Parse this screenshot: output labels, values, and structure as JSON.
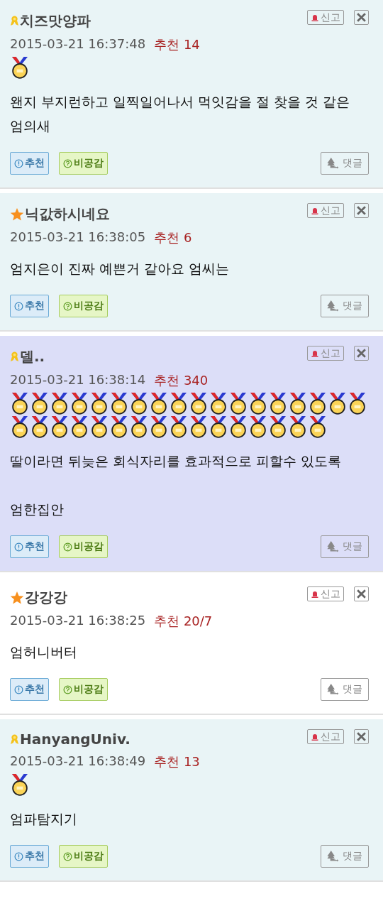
{
  "comments": [
    {
      "kind": "normal",
      "badge": {
        "kind": "ribbon"
      },
      "name": "치즈맛양파",
      "date": "2015-03-21 16:37:48",
      "recommend": "추천 14",
      "medals": [
        {
          "kind": "medal"
        }
      ],
      "body": "왠지 부지런하고 일찍일어나서 먹잇감을 절 찾을 것 같은\n엄의새",
      "report": "신고",
      "like": "추천",
      "dislike": "비공감",
      "reply": "댓글"
    },
    {
      "kind": "normal",
      "badge": {
        "kind": "star"
      },
      "name": "닉값하시네요",
      "date": "2015-03-21 16:38:05",
      "recommend": "추천 6",
      "body": "엄지은이 진짜 예쁜거 같아요 엄씨는",
      "report": "신고",
      "like": "추천",
      "dislike": "비공감",
      "reply": "댓글"
    },
    {
      "kind": "best",
      "badge": {
        "kind": "ribbon"
      },
      "name": "델..",
      "date": "2015-03-21 16:38:14",
      "recommend": "추천 340",
      "medals": [
        {
          "kind": "medal"
        },
        {
          "kind": "medal"
        },
        {
          "kind": "medal"
        },
        {
          "kind": "medal"
        },
        {
          "kind": "medal"
        },
        {
          "kind": "medal"
        },
        {
          "kind": "medal"
        },
        {
          "kind": "medal"
        },
        {
          "kind": "medal"
        },
        {
          "kind": "medal"
        },
        {
          "kind": "medal"
        },
        {
          "kind": "medal"
        },
        {
          "kind": "medal"
        },
        {
          "kind": "medal"
        },
        {
          "kind": "medal"
        },
        {
          "kind": "medal"
        },
        {
          "kind": "medal"
        },
        {
          "kind": "medal"
        },
        {
          "kind": "medal"
        },
        {
          "kind": "medal"
        },
        {
          "kind": "medal"
        },
        {
          "kind": "medal"
        },
        {
          "kind": "medal"
        },
        {
          "kind": "medal"
        },
        {
          "kind": "medal"
        },
        {
          "kind": "medal"
        },
        {
          "kind": "medal"
        },
        {
          "kind": "medal"
        },
        {
          "kind": "medal"
        },
        {
          "kind": "medal"
        },
        {
          "kind": "medal"
        },
        {
          "kind": "medal"
        },
        {
          "kind": "medal"
        },
        {
          "kind": "medal"
        }
      ],
      "body": "딸이라면 뒤늦은 회식자리를 효과적으로 피할수 있도록\n\n엄한집안",
      "report": "신고",
      "like": "추천",
      "dislike": "비공감",
      "reply": "댓글"
    },
    {
      "kind": "plain",
      "badge": {
        "kind": "star"
      },
      "name": "강강강",
      "date": "2015-03-21 16:38:25",
      "recommend": "추천 20/7",
      "body": "엄허니버터",
      "report": "신고",
      "like": "추천",
      "dislike": "비공감",
      "reply": "댓글"
    },
    {
      "kind": "normal",
      "badge": {
        "kind": "ribbon"
      },
      "name": "HanyangUniv.",
      "date": "2015-03-21 16:38:49",
      "recommend": "추천 13",
      "medals": [
        {
          "kind": "medal"
        }
      ],
      "body": "엄파탐지기",
      "report": "신고",
      "like": "추천",
      "dislike": "비공감",
      "reply": "댓글"
    }
  ]
}
